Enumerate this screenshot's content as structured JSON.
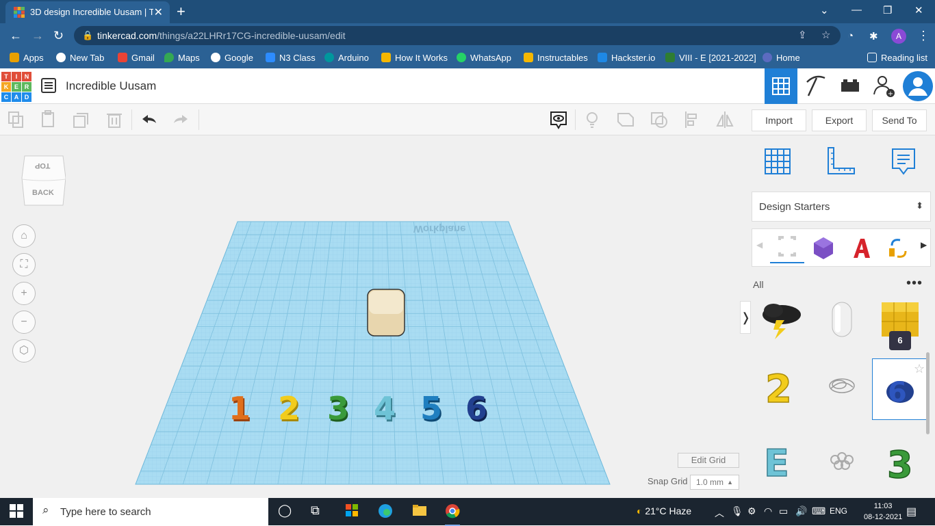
{
  "browser": {
    "tab_title": "3D design Incredible Uusam | Tin",
    "url_host": "tinkercad.com",
    "url_path": "/things/a22LHRr17CG-incredible-uusam/edit",
    "profile_initial": "A"
  },
  "bookmarks": [
    {
      "label": "Apps",
      "color": "#e8a000"
    },
    {
      "label": "New Tab",
      "color": "#ffffff"
    },
    {
      "label": "Gmail",
      "color": "#ea4335"
    },
    {
      "label": "Maps",
      "color": "#34a853"
    },
    {
      "label": "Google",
      "color": "#4285f4"
    },
    {
      "label": "N3 Class",
      "color": "#2d8cff"
    },
    {
      "label": "Arduino",
      "color": "#00979d"
    },
    {
      "label": "How It Works",
      "color": "#f5b700"
    },
    {
      "label": "WhatsApp",
      "color": "#25d366"
    },
    {
      "label": "Instructables",
      "color": "#f5b700"
    },
    {
      "label": "Hackster.io",
      "color": "#1e88e5"
    },
    {
      "label": "VIII - E [2021-2022]",
      "color": "#2e7d32"
    },
    {
      "label": "Home",
      "color": "#5c6bc0"
    }
  ],
  "reading_list": "Reading list",
  "app": {
    "logo_letters": [
      "T",
      "I",
      "N",
      "K",
      "E",
      "R",
      "C",
      "A",
      "D"
    ],
    "design_name": "Incredible Uusam"
  },
  "toolbar_right": {
    "import": "Import",
    "export": "Export",
    "send_to": "Send To"
  },
  "viewcube": {
    "top": "TOP",
    "back": "BACK"
  },
  "workplane": {
    "label": "Workplane",
    "edit_grid": "Edit Grid",
    "snap_grid_label": "Snap Grid",
    "snap_grid_value": "1.0 mm"
  },
  "numbers": [
    {
      "text": "1",
      "color": "#e06f1b"
    },
    {
      "text": "2",
      "color": "#f2cc1c"
    },
    {
      "text": "3",
      "color": "#3a9a3a"
    },
    {
      "text": "4",
      "color": "#6ec3d6"
    },
    {
      "text": "5",
      "color": "#1f7fc0"
    },
    {
      "text": "6",
      "color": "#22408f"
    }
  ],
  "panel": {
    "dropdown": "Design Starters",
    "filter": "All",
    "tooltip": "6"
  },
  "taskbar": {
    "search_placeholder": "Type here to search",
    "weather": "21°C  Haze",
    "lang": "ENG",
    "time": "11:03",
    "date": "08-12-2021"
  }
}
